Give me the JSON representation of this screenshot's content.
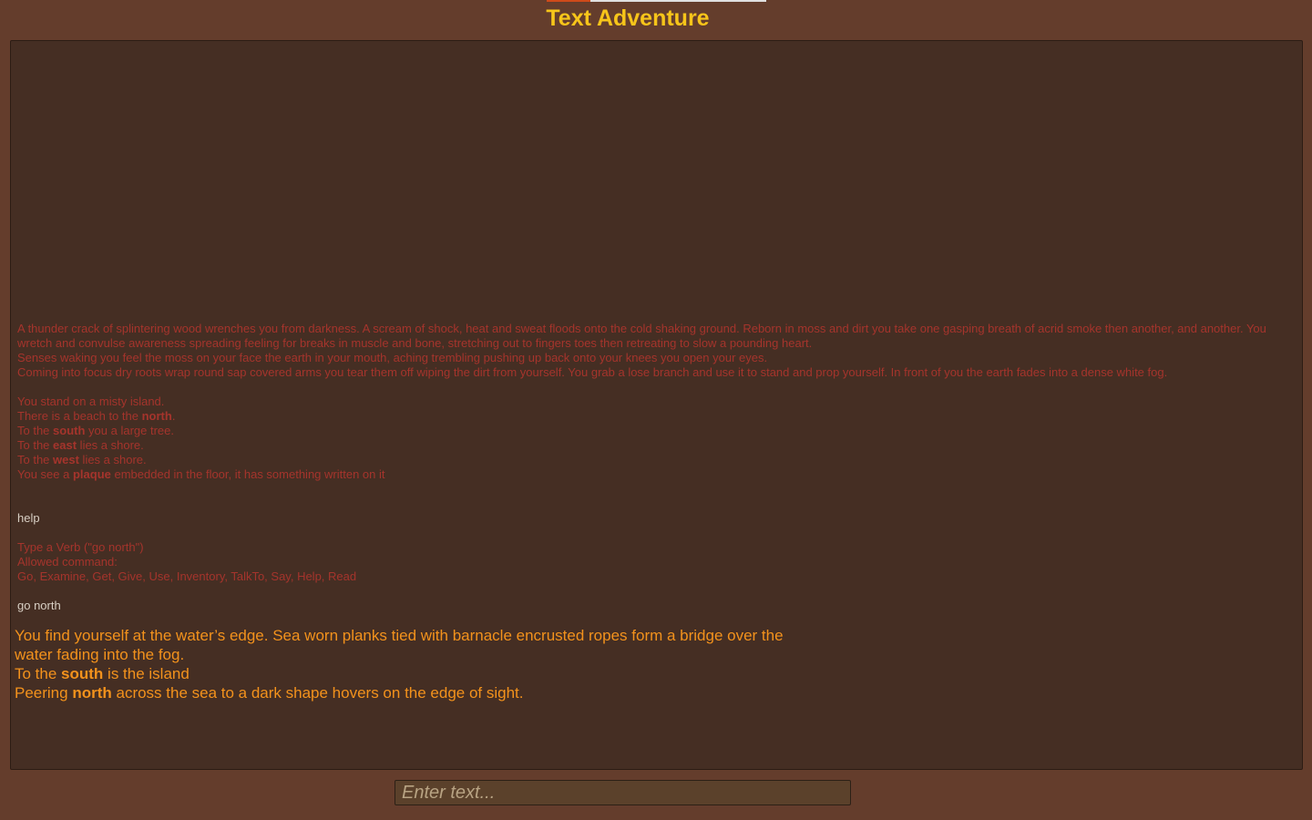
{
  "header": {
    "title": "Text Adventure",
    "progress": 0.2
  },
  "intro": {
    "lines": [
      "A thunder crack of splintering wood wrenches you from darkness. A scream of shock, heat and sweat floods onto the cold shaking ground. Reborn in moss and dirt you take one gasping breath of acrid smoke then another, and another. You wretch and convulse awareness spreading feeling for breaks in muscle and bone, stretching out to fingers toes then retreating to slow a pounding heart.",
      "Senses waking you feel the moss on your face the earth in your mouth, aching trembling pushing up back onto your knees you open your eyes.",
      "Coming into focus dry roots wrap round sap covered arms you tear them off wiping the dirt from yourself. You grab a lose branch and use it to stand and prop yourself. In front of you the earth fades into a dense white fog."
    ]
  },
  "room1": {
    "line1": "You stand on a misty island.",
    "north_pre": "There is a beach to the ",
    "north_word": "north",
    "north_post": ".",
    "south_pre": "To the ",
    "south_word": "south",
    "south_post": " you a large tree.",
    "east_pre": "To the ",
    "east_word": "east",
    "east_post": " lies a shore.",
    "west_pre": "To the ",
    "west_word": "west",
    "west_post": " lies a shore.",
    "plaque_pre": "You see a ",
    "plaque_word": "plaque",
    "plaque_post": " embedded in the floor, it has something written on it"
  },
  "command1": "help",
  "help": {
    "line1": "Type a Verb (\"go north\")",
    "line2": "Allowed command:",
    "line3": "Go, Examine, Get, Give, Use, Inventory, TalkTo, Say, Help, Read"
  },
  "command2": "go north",
  "current": {
    "line1": "You find yourself at the water’s edge. Sea worn planks tied with barnacle encrusted ropes form a bridge over the water fading into the fog.",
    "south_pre": "To the ",
    "south_word": "south",
    "south_post": " is the island",
    "north_pre": "Peering ",
    "north_word": "north",
    "north_post": " across the sea to a dark shape hovers on the edge of sight."
  },
  "input": {
    "placeholder": "Enter text..."
  },
  "colors": {
    "background": "#643d2c",
    "panel": "#452e23",
    "title": "#f7c51a",
    "history_text": "#a5342c",
    "command_text": "#d8cfc4",
    "current_text": "#f3921c"
  }
}
